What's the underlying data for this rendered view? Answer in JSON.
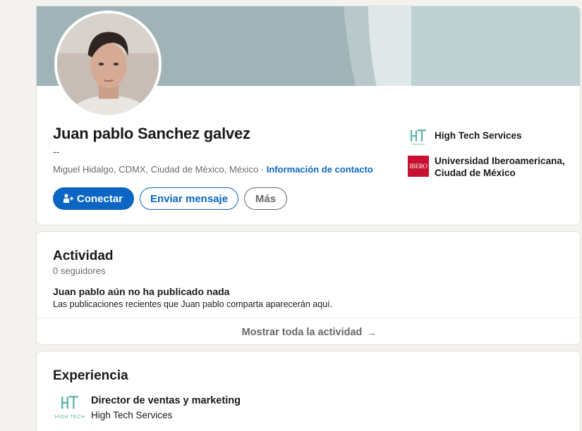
{
  "profile": {
    "name": "Juan pablo Sanchez galvez",
    "headline": "--",
    "location": "Miguel Hidalgo, CDMX, Ciudad de México, México",
    "separator": " · ",
    "contact_link": "Información de contacto",
    "actions": {
      "connect": "Conectar",
      "message": "Enviar mensaje",
      "more": "Más"
    },
    "organizations": [
      {
        "name": "High Tech Services",
        "logo": "high-tech-services-logo"
      },
      {
        "name": "Universidad Iberoamericana, Ciudad de México",
        "logo": "ibero-logo",
        "logo_text": "IBERO"
      }
    ]
  },
  "activity": {
    "title": "Actividad",
    "followers": "0 seguidores",
    "empty_title": "Juan pablo aún no ha publicado nada",
    "empty_desc": "Las publicaciones recientes que Juan pablo comparta aparecerán aquí.",
    "show_all": "Mostrar toda la actividad",
    "show_all_arrow": "→"
  },
  "experience": {
    "title": "Experiencia",
    "items": [
      {
        "role": "Director de ventas y marketing",
        "company": "High Tech Services",
        "logo_text": "HIGH TECH"
      }
    ]
  },
  "colors": {
    "primary": "#0a66c2",
    "banner": "#a0b4b7",
    "ibero_red": "#c8102e",
    "hts_teal": "#5fb3a8"
  }
}
